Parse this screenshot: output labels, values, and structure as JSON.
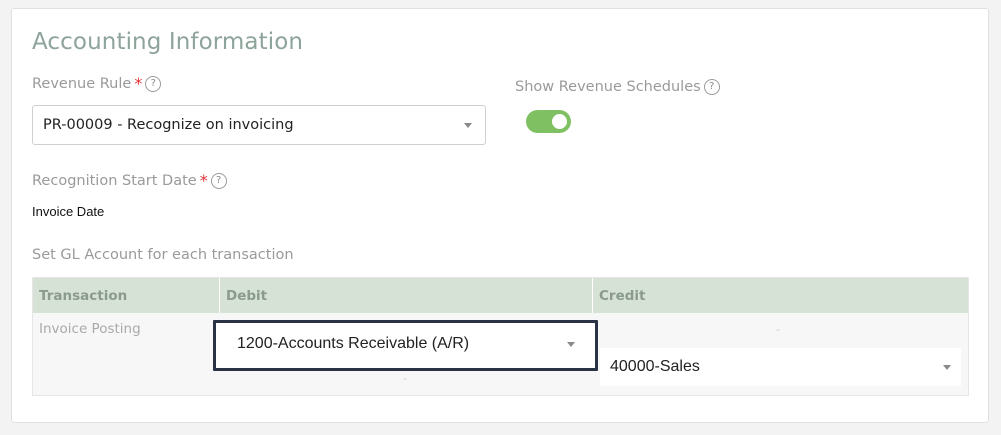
{
  "section": {
    "title": "Accounting Information"
  },
  "revenue_rule": {
    "label": "Revenue Rule",
    "required_mark": "*",
    "help": "?",
    "value": "PR-00009 - Recognize on invoicing"
  },
  "show_schedules": {
    "label": "Show Revenue Schedules",
    "help": "?",
    "enabled": true
  },
  "recognition_start": {
    "label": "Recognition Start Date",
    "required_mark": "*",
    "help": "?",
    "value": "Invoice Date"
  },
  "gl": {
    "title": "Set GL Account for each transaction",
    "columns": [
      "Transaction",
      "Debit",
      "Credit"
    ],
    "rows": [
      {
        "transaction": "Invoice Posting",
        "debit": "1200-Accounts Receivable (A/R)",
        "debit_dash": "-",
        "credit_dash": "-",
        "credit": "40000-Sales"
      }
    ]
  },
  "colors": {
    "title": "#8ea49a",
    "toggle_on": "#7fc062",
    "table_header": "#d7e2d6",
    "required": "#e03232",
    "highlight_border": "#2a3345"
  }
}
